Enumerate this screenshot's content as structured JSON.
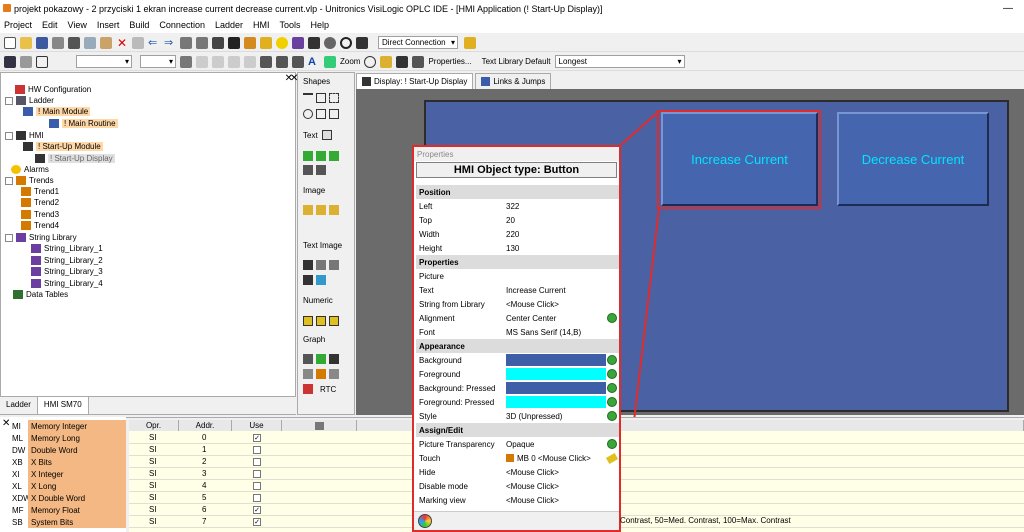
{
  "app": {
    "title": "projekt pokazowy - 2 przyciski 1 ekran increase current decrease current.vlp - Unitronics VisiLogic OPLC IDE - [HMI Application (! Start-Up Display)]"
  },
  "menu": [
    "Project",
    "Edit",
    "View",
    "Insert",
    "Build",
    "Connection",
    "Ladder",
    "HMI",
    "Tools",
    "Help"
  ],
  "toolbar": {
    "connection": "Direct Connection",
    "zoom_label": "Zoom",
    "properties_label": "Properties...",
    "text_library_label": "Text Library Default",
    "text_library_value": "Longest"
  },
  "tree": {
    "hw": "HW Configuration",
    "ladder": "Ladder",
    "main_module": "! Main Module",
    "main_routine": "! Main Routine",
    "hmi": "HMI",
    "startup_module": "! Start-Up Module",
    "startup_display": "! Start-Up Display",
    "alarms": "Alarms",
    "trends": "Trends",
    "trend1": "Trend1",
    "trend2": "Trend2",
    "trend3": "Trend3",
    "trend4": "Trend4",
    "string_library": "String Library",
    "sl1": "String_Library_1",
    "sl2": "String_Library_2",
    "sl3": "String_Library_3",
    "sl4": "String_Library_4",
    "data_tables": "Data Tables"
  },
  "bottom_tabs": [
    "Ladder",
    "HMI SM70"
  ],
  "palette": {
    "shapes": "Shapes",
    "text": "Text",
    "image": "Image",
    "text_image": "Text Image",
    "numeric": "Numeric",
    "graph": "Graph",
    "rtc": "RTC"
  },
  "display_tabs": [
    "Display: ! Start-Up Display",
    "Links & Jumps"
  ],
  "hmi_buttons": {
    "increase": "Increase Current",
    "decrease": "Decrease Current"
  },
  "properties": {
    "header": "Properties",
    "object_type": "HMI Object type: Button",
    "position_section": "Position",
    "left_label": "Left",
    "left": "322",
    "top_label": "Top",
    "top": "20",
    "width_label": "Width",
    "width": "220",
    "height_label": "Height",
    "height": "130",
    "properties_section": "Properties",
    "picture_label": "Picture",
    "text_label": "Text",
    "text": "Increase Current",
    "string_lib_label": "String from Library",
    "string_lib": "<Mouse Click>",
    "alignment_label": "Alignment",
    "alignment": "Center Center",
    "font_label": "Font",
    "font": "MS Sans Serif (14,B)",
    "appearance_section": "Appearance",
    "background_label": "Background",
    "foreground_label": "Foreground",
    "bg_pressed_label": "Background: Pressed",
    "fg_pressed_label": "Foreground: Pressed",
    "style_label": "Style",
    "style": "3D (Unpressed)",
    "assign_section": "Assign/Edit",
    "transparency_label": "Picture Transparency",
    "transparency": "Opaque",
    "touch_label": "Touch",
    "touch": "MB 0 <Mouse Click>",
    "hide_label": "Hide",
    "hide": "<Mouse Click>",
    "disable_label": "Disable mode",
    "disable": "<Mouse Click>",
    "marking_label": "Marking view",
    "marking": "<Mouse Click>",
    "colors": {
      "background": "#3e5ea8",
      "foreground": "#00ffff",
      "bg_pressed": "#3e5ea8",
      "fg_pressed": "#00ffff"
    }
  },
  "variables": [
    {
      "code": "MI",
      "name": "Memory Integer"
    },
    {
      "code": "ML",
      "name": "Memory Long"
    },
    {
      "code": "DW",
      "name": "Double Word"
    },
    {
      "code": "XB",
      "name": "X Bits"
    },
    {
      "code": "XI",
      "name": "X Integer"
    },
    {
      "code": "XL",
      "name": "X Long"
    },
    {
      "code": "XDW",
      "name": "X Double Word"
    },
    {
      "code": "MF",
      "name": "Memory Float"
    },
    {
      "code": "SB",
      "name": "System Bits"
    }
  ],
  "grid": {
    "headers": [
      "Opr.",
      "Addr.",
      "Use"
    ],
    "rows": [
      {
        "opr": "SI",
        "addr": "0",
        "use": true
      },
      {
        "opr": "SI",
        "addr": "1",
        "use": false
      },
      {
        "opr": "SI",
        "addr": "2",
        "use": false
      },
      {
        "opr": "SI",
        "addr": "3",
        "use": false
      },
      {
        "opr": "SI",
        "addr": "4",
        "use": false
      },
      {
        "opr": "SI",
        "addr": "5",
        "use": false
      },
      {
        "opr": "SI",
        "addr": "6",
        "use": true
      },
      {
        "opr": "SI",
        "addr": "7",
        "use": true
      }
    ],
    "status_text": "Contrast, 50=Med. Contrast, 100=Max. Contrast"
  }
}
